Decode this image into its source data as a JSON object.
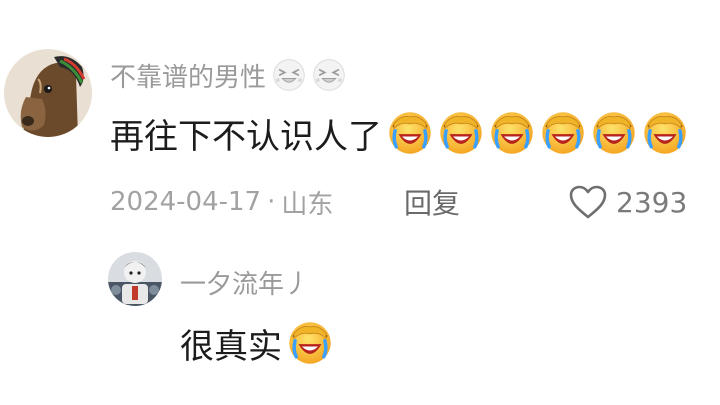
{
  "comment": {
    "author": "不靠谱的男性",
    "author_emojis": [
      "squint-laugh-emoji",
      "squint-laugh-emoji"
    ],
    "text": "再往下不认识人了",
    "text_emojis": [
      "facepalm-laugh-emoji",
      "facepalm-laugh-emoji",
      "facepalm-laugh-emoji",
      "facepalm-laugh-emoji",
      "facepalm-laugh-emoji",
      "facepalm-laugh-emoji"
    ],
    "date": "2024-04-17",
    "separator": "·",
    "location": "山东",
    "reply_label": "回复",
    "like_icon": "heart-outline-icon",
    "like_count": "2393"
  },
  "reply": {
    "author": "一夕流年丿",
    "text": "很真实",
    "text_emojis": [
      "facepalm-laugh-emoji"
    ]
  },
  "colors": {
    "author": "#9a9a9a",
    "content": "#1c1c1c",
    "meta": "#a2a2a2",
    "emoji_face": "#ffc83d"
  }
}
